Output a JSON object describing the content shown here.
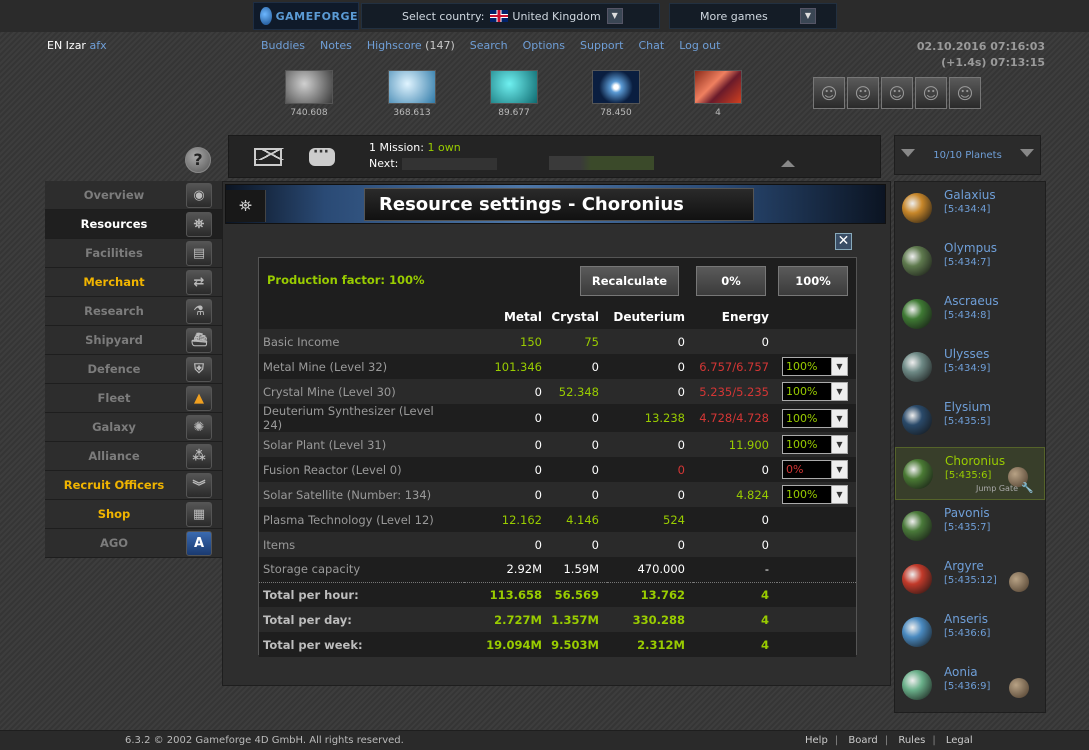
{
  "topbar": {
    "logo_text": "GAMEFORGE",
    "country_label": "Select country:",
    "country_value": "United Kingdom",
    "more_games": "More games"
  },
  "header": {
    "server": "EN Izar",
    "player_name": "afx",
    "nav": {
      "buddies": "Buddies",
      "notes": "Notes",
      "highscore": "Highscore",
      "highscore_rank": "(147)",
      "search": "Search",
      "options": "Options",
      "support": "Support",
      "chat": "Chat",
      "logout": "Log out"
    },
    "datetime": "02.10.2016 07:16:03",
    "server_offset": "(+1.4s) 07:13:15"
  },
  "resources": [
    {
      "name": "metal",
      "amount": "740.608",
      "color": "#6d6d6d"
    },
    {
      "name": "crystal",
      "amount": "368.613",
      "color": "#5ba3d0"
    },
    {
      "name": "deuterium",
      "amount": "89.677",
      "color": "#2ab0b8"
    },
    {
      "name": "energy",
      "amount": "78.450",
      "color": "#1b3c7a"
    },
    {
      "name": "dark-matter",
      "amount": "4",
      "color": "#b8401a"
    }
  ],
  "missions": {
    "count_label": "1 Mission:",
    "own_label": "1 own",
    "next_label": "Next:"
  },
  "planet_count": "10/10 Planets",
  "menu": [
    {
      "key": "overview",
      "label": "Overview",
      "icon": "◉",
      "state": "normal"
    },
    {
      "key": "resources",
      "label": "Resources",
      "icon": "⛯",
      "state": "active"
    },
    {
      "key": "facilities",
      "label": "Facilities",
      "icon": "▤",
      "state": "normal"
    },
    {
      "key": "merchant",
      "label": "Merchant",
      "icon": "⇄",
      "state": "gold"
    },
    {
      "key": "research",
      "label": "Research",
      "icon": "⚗",
      "state": "normal"
    },
    {
      "key": "shipyard",
      "label": "Shipyard",
      "icon": "⛴",
      "state": "normal"
    },
    {
      "key": "defence",
      "label": "Defence",
      "icon": "⛨",
      "state": "normal"
    },
    {
      "key": "fleet",
      "label": "Fleet",
      "icon": "▲",
      "state": "normal"
    },
    {
      "key": "galaxy",
      "label": "Galaxy",
      "icon": "✺",
      "state": "normal"
    },
    {
      "key": "alliance",
      "label": "Alliance",
      "icon": "⁂",
      "state": "normal"
    },
    {
      "key": "recruit-officers",
      "label": "Recruit Officers",
      "icon": "︾",
      "state": "gold"
    },
    {
      "key": "shop",
      "label": "Shop",
      "icon": "▦",
      "state": "gold"
    },
    {
      "key": "ago",
      "label": "AGO",
      "icon": "A",
      "state": "normal"
    }
  ],
  "page": {
    "title": "Resource settings - Choronius",
    "production_factor": "Production factor: 100%",
    "buttons": {
      "recalculate": "Recalculate",
      "zero": "0%",
      "hundred": "100%"
    },
    "columns": [
      "Metal",
      "Crystal",
      "Deuterium",
      "Energy"
    ],
    "rows": [
      {
        "label": "Basic Income",
        "metal": "150",
        "crystal": "75",
        "deut": "0",
        "energy": "0",
        "c_metal": "g",
        "c_crystal": "g",
        "c_deut": "",
        "c_energy": ""
      },
      {
        "label": "Metal Mine (Level 32)",
        "metal": "101.346",
        "crystal": "0",
        "deut": "0",
        "energy": "6.757/6.757",
        "c_metal": "g",
        "c_crystal": "",
        "c_deut": "",
        "c_energy": "r",
        "pct": "100%"
      },
      {
        "label": "Crystal Mine (Level 30)",
        "metal": "0",
        "crystal": "52.348",
        "deut": "0",
        "energy": "5.235/5.235",
        "c_metal": "",
        "c_crystal": "g",
        "c_deut": "",
        "c_energy": "r",
        "pct": "100%"
      },
      {
        "label": "Deuterium Synthesizer (Level 24)",
        "metal": "0",
        "crystal": "0",
        "deut": "13.238",
        "energy": "4.728/4.728",
        "c_metal": "",
        "c_crystal": "",
        "c_deut": "g",
        "c_energy": "r",
        "pct": "100%"
      },
      {
        "label": "Solar Plant (Level 31)",
        "metal": "0",
        "crystal": "0",
        "deut": "0",
        "energy": "11.900",
        "c_metal": "",
        "c_crystal": "",
        "c_deut": "",
        "c_energy": "g",
        "pct": "100%"
      },
      {
        "label": "Fusion Reactor (Level 0)",
        "metal": "0",
        "crystal": "0",
        "deut": "0",
        "energy": "0",
        "c_metal": "",
        "c_crystal": "",
        "c_deut": "r",
        "c_energy": "",
        "pct": "0%",
        "pct_red": true
      },
      {
        "label": "Solar Satellite (Number: 134)",
        "metal": "0",
        "crystal": "0",
        "deut": "0",
        "energy": "4.824",
        "c_metal": "",
        "c_crystal": "",
        "c_deut": "",
        "c_energy": "g",
        "pct": "100%"
      },
      {
        "label": "Plasma Technology (Level 12)",
        "metal": "12.162",
        "crystal": "4.146",
        "deut": "524",
        "energy": "0",
        "c_metal": "g",
        "c_crystal": "g",
        "c_deut": "g",
        "c_energy": ""
      },
      {
        "label": "Items",
        "metal": "0",
        "crystal": "0",
        "deut": "0",
        "energy": "0",
        "c_metal": "",
        "c_crystal": "",
        "c_deut": "",
        "c_energy": ""
      },
      {
        "label": "Storage capacity",
        "metal": "2.92M",
        "crystal": "1.59M",
        "deut": "470.000",
        "energy": "-",
        "c_metal": "",
        "c_crystal": "",
        "c_deut": "",
        "c_energy": ""
      }
    ],
    "totals": [
      {
        "label": "Total per hour:",
        "metal": "113.658",
        "crystal": "56.569",
        "deut": "13.762",
        "energy": "4"
      },
      {
        "label": "Total per day:",
        "metal": "2.727M",
        "crystal": "1.357M",
        "deut": "330.288",
        "energy": "4"
      },
      {
        "label": "Total per week:",
        "metal": "19.094M",
        "crystal": "9.503M",
        "deut": "2.312M",
        "energy": "4"
      }
    ]
  },
  "planets": [
    {
      "name": "Galaxius",
      "coords": "[5:434:4]",
      "color": "#c8872a",
      "moon": false
    },
    {
      "name": "Olympus",
      "coords": "[5:434:7]",
      "color": "#5f7a4e",
      "moon": false
    },
    {
      "name": "Ascraeus",
      "coords": "[5:434:8]",
      "color": "#3f7a34",
      "moon": false
    },
    {
      "name": "Ulysses",
      "coords": "[5:434:9]",
      "color": "#6e8a86",
      "moon": false
    },
    {
      "name": "Elysium",
      "coords": "[5:435:5]",
      "color": "#2a4a6a",
      "moon": false
    },
    {
      "name": "Choronius",
      "coords": "[5:435:6]",
      "color": "#4a7a34",
      "moon": true,
      "active": true,
      "jump_gate": "Jump Gate"
    },
    {
      "name": "Pavonis",
      "coords": "[5:435:7]",
      "color": "#4a7a3a",
      "moon": false
    },
    {
      "name": "Argyre",
      "coords": "[5:435:12]",
      "color": "#c23a2a",
      "moon": true
    },
    {
      "name": "Anseris",
      "coords": "[5:436:6]",
      "color": "#4a8ac0",
      "moon": false
    },
    {
      "name": "Aonia",
      "coords": "[5:436:9]",
      "color": "#6ab08a",
      "moon": true
    }
  ],
  "footer": {
    "copyright": "6.3.2  © 2002 Gameforge 4D GmbH. All rights reserved.",
    "help": "Help",
    "board": "Board",
    "rules": "Rules",
    "legal": "Legal"
  }
}
